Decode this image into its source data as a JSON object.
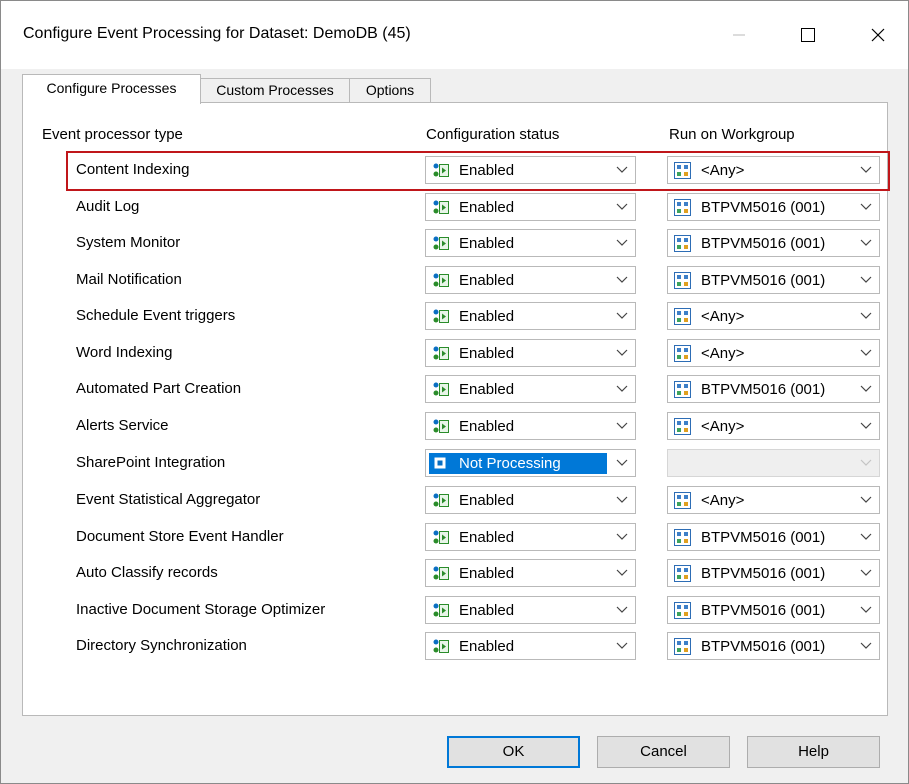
{
  "window": {
    "title": "Configure Event Processing for Dataset: DemoDB (45)"
  },
  "tabs": [
    {
      "label": "Configure Processes"
    },
    {
      "label": "Custom Processes"
    },
    {
      "label": "Options"
    }
  ],
  "columns": {
    "type": "Event processor type",
    "status": "Configuration status",
    "workgroup": "Run on Workgroup"
  },
  "rows": [
    {
      "label": "Content Indexing",
      "status": "Enabled",
      "workgroup": "<Any>"
    },
    {
      "label": "Audit Log",
      "status": "Enabled",
      "workgroup": "BTPVM5016 (001)"
    },
    {
      "label": "System Monitor",
      "status": "Enabled",
      "workgroup": "BTPVM5016 (001)"
    },
    {
      "label": "Mail Notification",
      "status": "Enabled",
      "workgroup": "BTPVM5016 (001)"
    },
    {
      "label": "Schedule Event triggers",
      "status": "Enabled",
      "workgroup": "<Any>"
    },
    {
      "label": "Word Indexing",
      "status": "Enabled",
      "workgroup": "<Any>"
    },
    {
      "label": "Automated Part Creation",
      "status": "Enabled",
      "workgroup": "BTPVM5016 (001)"
    },
    {
      "label": "Alerts Service",
      "status": "Enabled",
      "workgroup": "<Any>"
    },
    {
      "label": "SharePoint Integration",
      "status": "Not Processing",
      "workgroup": ""
    },
    {
      "label": "Event Statistical Aggregator",
      "status": "Enabled",
      "workgroup": "<Any>"
    },
    {
      "label": "Document Store Event Handler",
      "status": "Enabled",
      "workgroup": "BTPVM5016 (001)"
    },
    {
      "label": "Auto Classify records",
      "status": "Enabled",
      "workgroup": "BTPVM5016 (001)"
    },
    {
      "label": "Inactive Document Storage Optimizer",
      "status": "Enabled",
      "workgroup": "BTPVM5016 (001)"
    },
    {
      "label": "Directory Synchronization",
      "status": "Enabled",
      "workgroup": "BTPVM5016 (001)"
    }
  ],
  "buttons": {
    "ok": "OK",
    "cancel": "Cancel",
    "help": "Help"
  },
  "colors": {
    "highlight_border": "#c0161a",
    "selection": "#0078d7"
  }
}
